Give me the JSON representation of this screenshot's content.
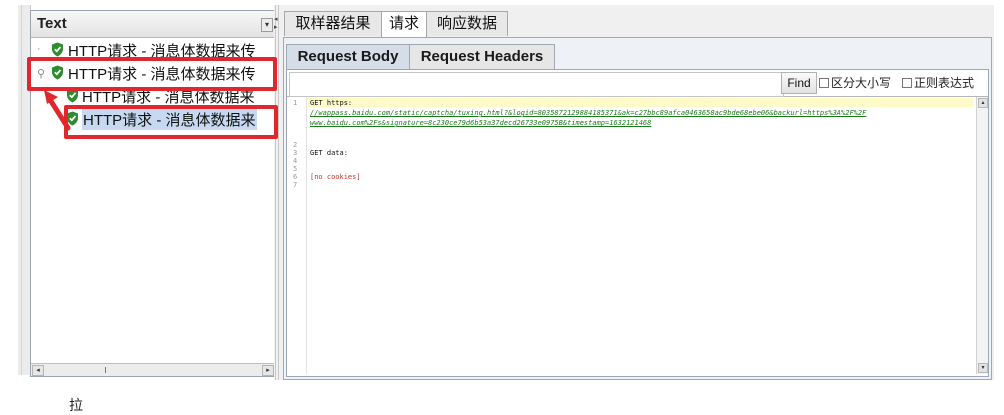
{
  "tree_panel": {
    "column_header": "Text",
    "dropdown_glyph": "▾",
    "items": [
      {
        "label": "HTTP请求 - 消息体数据来传",
        "status_icon": "shield-check-icon"
      },
      {
        "label": "HTTP请求 - 消息体数据来传",
        "status_icon": "shield-check-icon",
        "expanded": true
      },
      {
        "label": "HTTP请求 - 消息体数据来",
        "status_icon": "shield-check-icon"
      },
      {
        "label": "HTTP请求 - 消息体数据来",
        "status_icon": "shield-check-icon",
        "selected": true
      }
    ]
  },
  "main_tabs": [
    {
      "label": "取样器结果",
      "selected": false
    },
    {
      "label": "请求",
      "selected": true
    },
    {
      "label": "响应数据",
      "selected": false
    }
  ],
  "sub_tabs": [
    {
      "label": "Request Body",
      "selected": true
    },
    {
      "label": "Request Headers",
      "selected": false
    }
  ],
  "find_bar": {
    "search_value": "",
    "find_button": "Find",
    "case_sensitive_label": "区分大小写",
    "regex_label": "正则表达式"
  },
  "editor": {
    "line_numbers": [
      "1",
      "2",
      "3",
      "4",
      "5",
      "6",
      "7"
    ],
    "lines": {
      "l1": "GET https:",
      "l1_url_a": "//wappass.baidu.com/static/captcha/tuxing.html?&logid=8035872129884185371&ak=c27bbc89afca0463650ac9bde68ebe06&backurl=https%3A%2F%2F",
      "l1_url_b": "www.baidu.com%2Fs&signature=8c230ce79d6b53a37decd26733e0975B&timestamp=1632121468",
      "l3": "GET data:",
      "l6": "[no cookies]"
    }
  },
  "footer_char": "拉",
  "colors": {
    "annotation_red": "#e0272e",
    "shield_green": "#2e8b2e",
    "current_line": "#fefbc8",
    "url_green": "#1c7a1c",
    "cookies_red": "#c0392b"
  }
}
